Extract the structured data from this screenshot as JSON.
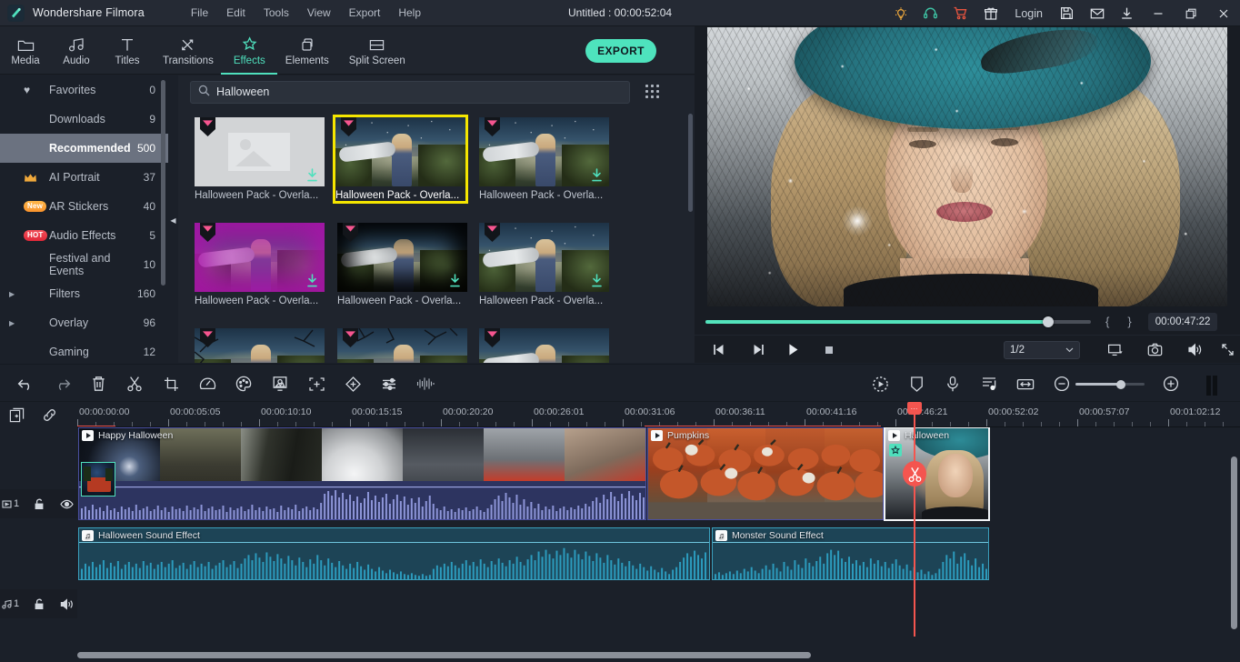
{
  "app": {
    "brand": "Wondershare Filmora",
    "logo_icon": "filmora-logo-icon",
    "document_title": "Untitled : 00:00:52:04",
    "menus": [
      "File",
      "Edit",
      "Tools",
      "View",
      "Export",
      "Help"
    ],
    "titlebar_icons": [
      "lightbulb-icon",
      "headset-support-icon",
      "shopping-cart-icon",
      "gift-icon"
    ],
    "login_label": "Login",
    "right_icons": [
      "save-icon",
      "mail-icon",
      "download-icon"
    ],
    "window_controls": [
      "minimize-icon",
      "maximize-icon",
      "close-icon"
    ]
  },
  "tabs": [
    {
      "label": "Media",
      "icon": "folder-icon",
      "active": false
    },
    {
      "label": "Audio",
      "icon": "music-note-icon",
      "active": false
    },
    {
      "label": "Titles",
      "icon": "text-t-icon",
      "active": false
    },
    {
      "label": "Transitions",
      "icon": "transition-arrows-icon",
      "active": false
    },
    {
      "label": "Effects",
      "icon": "magic-star-icon",
      "active": true
    },
    {
      "label": "Elements",
      "icon": "layers-icon",
      "active": false
    },
    {
      "label": "Split Screen",
      "icon": "split-screen-icon",
      "active": false
    }
  ],
  "export_button": "EXPORT",
  "sidebar": {
    "items": [
      {
        "label": "Favorites",
        "count": "0",
        "badge": "",
        "icon": "heart-icon",
        "expandable": false,
        "selected": false
      },
      {
        "label": "Downloads",
        "count": "9",
        "badge": "",
        "icon": "",
        "expandable": false,
        "selected": false
      },
      {
        "label": "Recommended",
        "count": "500",
        "badge": "",
        "icon": "",
        "expandable": false,
        "selected": true
      },
      {
        "label": "AI Portrait",
        "count": "37",
        "badge": "",
        "icon": "crown-icon",
        "expandable": false,
        "selected": false
      },
      {
        "label": "AR Stickers",
        "count": "40",
        "badge": "New",
        "icon": "",
        "expandable": false,
        "selected": false
      },
      {
        "label": "Audio Effects",
        "count": "5",
        "badge": "HOT",
        "icon": "",
        "expandable": false,
        "selected": false
      },
      {
        "label": "Festival and Events",
        "count": "10",
        "badge": "",
        "icon": "",
        "expandable": false,
        "selected": false
      },
      {
        "label": "Filters",
        "count": "160",
        "badge": "",
        "icon": "",
        "expandable": true,
        "selected": false
      },
      {
        "label": "Overlay",
        "count": "96",
        "badge": "",
        "icon": "",
        "expandable": true,
        "selected": false
      },
      {
        "label": "Gaming",
        "count": "12",
        "badge": "",
        "icon": "",
        "expandable": false,
        "selected": false
      }
    ],
    "collapse_icon": "collapse-left-icon"
  },
  "browser": {
    "search": {
      "value": "Halloween",
      "placeholder": "Search",
      "icon": "search-icon"
    },
    "grid_view_icon": "grid-view-icon",
    "effects": [
      {
        "caption": "Halloween Pack - Overla...",
        "scene": "placeholder",
        "gem": true,
        "download": true,
        "selected": false
      },
      {
        "caption": "Halloween Pack - Overla...",
        "scene": "field",
        "gem": true,
        "download": false,
        "selected": true
      },
      {
        "caption": "Halloween Pack - Overla...",
        "scene": "field-stars",
        "gem": true,
        "download": true,
        "selected": false
      },
      {
        "caption": "Halloween Pack - Overla...",
        "scene": "field-purple",
        "gem": true,
        "download": true,
        "selected": false
      },
      {
        "caption": "Halloween Pack - Overla...",
        "scene": "field-dark",
        "gem": true,
        "download": true,
        "selected": false
      },
      {
        "caption": "Halloween Pack - Overla...",
        "scene": "field-stars",
        "gem": true,
        "download": true,
        "selected": false
      },
      {
        "caption": "",
        "scene": "field-branches",
        "gem": true,
        "download": false,
        "selected": false
      },
      {
        "caption": "",
        "scene": "field-branches",
        "gem": true,
        "download": false,
        "selected": false
      },
      {
        "caption": "",
        "scene": "field",
        "gem": true,
        "download": false,
        "selected": false
      }
    ]
  },
  "preview": {
    "current_time": "00:00:47:22",
    "seek_percent": 88,
    "mark_in_icon": "mark-in-brace",
    "mark_out_icon": "mark-out-brace",
    "controls": [
      {
        "name": "prev-frame-button",
        "icon": "step-backward-icon"
      },
      {
        "name": "next-frame-button",
        "icon": "step-forward-icon"
      },
      {
        "name": "play-button",
        "icon": "play-icon"
      },
      {
        "name": "stop-button",
        "icon": "stop-icon"
      }
    ],
    "speed": "1/2",
    "speed_caret": "chevron-down-icon",
    "right_controls": [
      {
        "name": "display-settings-button",
        "icon": "monitor-icon"
      },
      {
        "name": "snapshot-button",
        "icon": "camera-icon"
      },
      {
        "name": "volume-button",
        "icon": "speaker-icon"
      },
      {
        "name": "fullscreen-button",
        "icon": "expand-arrows-icon"
      }
    ]
  },
  "edit_toolbar": {
    "left_tools": [
      {
        "name": "undo-button",
        "icon": "undo-arrow-icon"
      },
      {
        "name": "redo-button",
        "icon": "redo-arrow-icon"
      },
      {
        "name": "delete-button",
        "icon": "trash-icon"
      },
      {
        "name": "split-button",
        "icon": "scissors-icon"
      },
      {
        "name": "crop-button",
        "icon": "crop-icon"
      },
      {
        "name": "speed-button",
        "icon": "speedometer-icon"
      },
      {
        "name": "color-button",
        "icon": "palette-icon"
      },
      {
        "name": "green-screen-button",
        "icon": "chroma-key-icon"
      },
      {
        "name": "auto-enhance-button",
        "icon": "enhance-brackets-icon"
      },
      {
        "name": "keyframe-button",
        "icon": "diamond-keyframe-icon"
      },
      {
        "name": "adjust-button",
        "icon": "sliders-icon"
      },
      {
        "name": "audio-detach-button",
        "icon": "audio-waveform-icon"
      }
    ],
    "right_tools": [
      {
        "name": "render-preview-button",
        "icon": "render-dashed-play-icon"
      },
      {
        "name": "marker-button",
        "icon": "marker-shield-icon"
      },
      {
        "name": "voiceover-button",
        "icon": "microphone-icon"
      },
      {
        "name": "audio-mixer-button",
        "icon": "mixer-note-icon"
      },
      {
        "name": "fit-timeline-button",
        "icon": "fit-width-icon"
      },
      {
        "name": "zoom-out-button",
        "icon": "minus-circle-icon"
      },
      {
        "name": "zoom-in-button",
        "icon": "plus-circle-icon"
      }
    ],
    "zoom_value": 60
  },
  "timeline": {
    "head_buttons": [
      {
        "name": "add-track-button",
        "icon": "add-media-icon"
      },
      {
        "name": "link-clips-button",
        "icon": "link-icon"
      }
    ],
    "ruler_labels": [
      "00:00:00:00",
      "00:00:05:05",
      "00:00:10:10",
      "00:00:15:15",
      "00:00:20:20",
      "00:00:26:01",
      "00:00:31:06",
      "00:00:36:11",
      "00:00:41:16",
      "00:00:46:21",
      "00:00:52:02",
      "00:00:57:07",
      "00:01:02:12"
    ],
    "playhead_time": "00:00:46:21",
    "video_track": {
      "label": "1",
      "icon": "video-track-icon",
      "lock_icon": "unlocked-icon",
      "eye_icon": "eye-visible-icon",
      "clips": [
        {
          "title": "Happy Halloween",
          "selected": false
        },
        {
          "title": "Pumpkins",
          "selected": false
        },
        {
          "title": "Halloween",
          "selected": true,
          "has_effect_badge": true,
          "effect_badge_icon": "magic-star-icon",
          "cut_badge_icon": "scissors-icon"
        }
      ]
    },
    "audio_track": {
      "label": "1",
      "icon": "audio-track-icon",
      "lock_icon": "unlocked-icon",
      "mute_icon": "speaker-on-icon",
      "clips": [
        {
          "title": "Halloween Sound Effect"
        },
        {
          "title": "Monster Sound Effect"
        }
      ]
    }
  },
  "colors": {
    "accent": "#4fe0bd",
    "selection_yellow": "#f5e600",
    "playhead_red": "#f4554f",
    "video_clip": "#2a3150",
    "audio_clip": "#1d4456",
    "window_bg": "#1b2029",
    "titlebar_bg": "#252a34"
  }
}
